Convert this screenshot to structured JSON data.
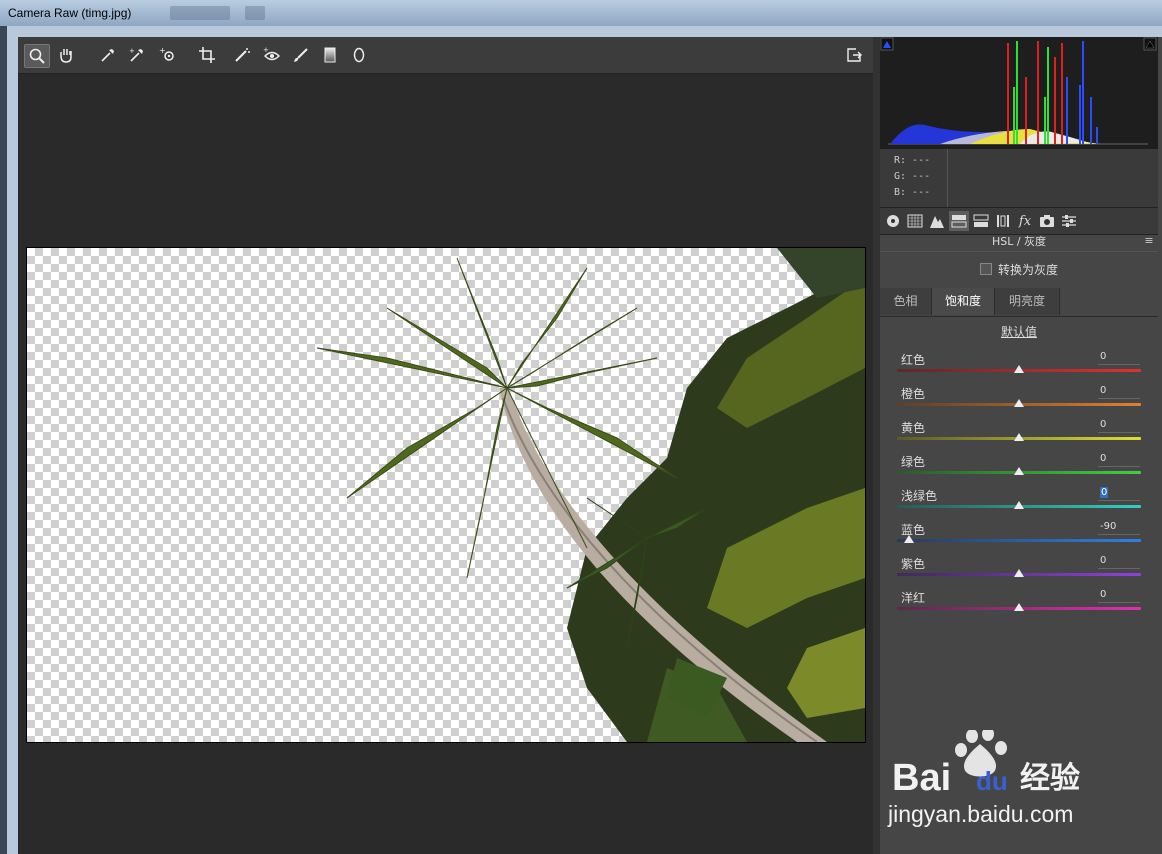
{
  "window": {
    "title": "Camera Raw (timg.jpg)"
  },
  "toolbar": {
    "tools": [
      "zoom-icon",
      "hand-icon",
      "white-balance-icon",
      "color-sampler-icon",
      "targeted-adjust-icon",
      "crop-icon",
      "spot-removal-icon",
      "red-eye-icon",
      "adjustment-brush-icon",
      "graduated-filter-icon",
      "radial-filter-icon"
    ],
    "export_icon": "open-preferences-icon"
  },
  "readout": {
    "r": "R: ---",
    "g": "G: ---",
    "b": "B: ---"
  },
  "panel_tabs": [
    "basic-icon",
    "tone-curve-icon",
    "detail-icon",
    "hsl-icon",
    "split-toning-icon",
    "lens-icon",
    "effects-icon",
    "camera-calibration-icon",
    "presets-icon"
  ],
  "panel": {
    "header": "HSL / 灰度",
    "convert_gray": "转换为灰度",
    "tabs": [
      "色相",
      "饱和度",
      "明亮度"
    ],
    "active_tab": "饱和度",
    "defaults": "默认值",
    "sliders": [
      {
        "label": "红色",
        "value": "0",
        "level": 0,
        "colors": [
          "#5a2a2a",
          "#e03030"
        ]
      },
      {
        "label": "橙色",
        "value": "0",
        "level": 0,
        "colors": [
          "#5a402a",
          "#e08030"
        ]
      },
      {
        "label": "黄色",
        "value": "0",
        "level": 0,
        "colors": [
          "#5a5a2a",
          "#e0e030"
        ]
      },
      {
        "label": "绿色",
        "value": "0",
        "level": 0,
        "colors": [
          "#2a5a2a",
          "#40d040"
        ]
      },
      {
        "label": "浅绿色",
        "value": "0",
        "level": 0,
        "colors": [
          "#2a5a55",
          "#30d0c0"
        ]
      },
      {
        "label": "蓝色",
        "value": "-90",
        "level": -90,
        "colors": [
          "#2a3a5a",
          "#3080e0"
        ]
      },
      {
        "label": "紫色",
        "value": "0",
        "level": 0,
        "colors": [
          "#402a5a",
          "#9040e0"
        ]
      },
      {
        "label": "洋红",
        "value": "0",
        "level": 0,
        "colors": [
          "#5a2a4a",
          "#e030b0"
        ]
      }
    ]
  },
  "watermark": {
    "brand": "Bai",
    "brand2": "du",
    "cn": "经验",
    "url": "jingyan.baidu.com"
  }
}
